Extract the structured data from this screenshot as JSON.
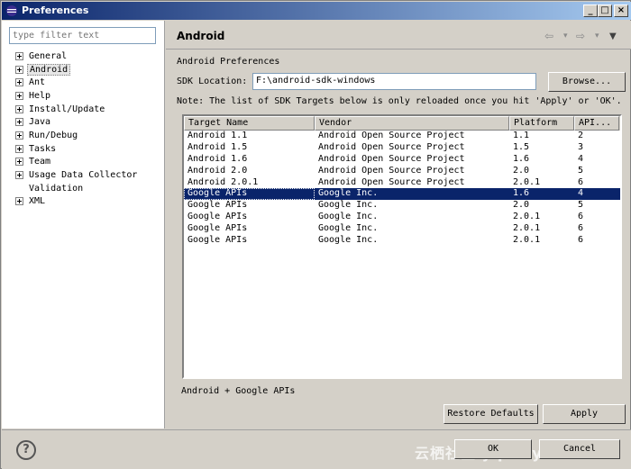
{
  "window": {
    "title": "Preferences",
    "minimize": "_",
    "maximize": "□",
    "close": "×"
  },
  "left": {
    "filter_placeholder": "type filter text",
    "tree": [
      {
        "label": "General",
        "expandable": true
      },
      {
        "label": "Android",
        "expandable": true,
        "selected": true
      },
      {
        "label": "Ant",
        "expandable": true
      },
      {
        "label": "Help",
        "expandable": true
      },
      {
        "label": "Install/Update",
        "expandable": true
      },
      {
        "label": "Java",
        "expandable": true
      },
      {
        "label": "Run/Debug",
        "expandable": true
      },
      {
        "label": "Tasks",
        "expandable": true
      },
      {
        "label": "Team",
        "expandable": true
      },
      {
        "label": "Usage Data Collector",
        "expandable": true
      },
      {
        "label": "Validation",
        "expandable": false
      },
      {
        "label": "XML",
        "expandable": true
      }
    ]
  },
  "page": {
    "title": "Android",
    "nav_back": "⇦",
    "nav_back_menu": "▾",
    "nav_forward": "⇨",
    "nav_forward_menu": "▾",
    "nav_menu": "▼",
    "section_label": "Android Preferences",
    "sdk_label": "SDK Location:",
    "sdk_value": "F:\\android-sdk-windows",
    "browse_label": "Browse...",
    "note": "Note: The list of SDK Targets below is only reloaded once you hit 'Apply' or 'OK'."
  },
  "table": {
    "headers": [
      "Target Name",
      "Vendor",
      "Platform",
      "API..."
    ],
    "rows": [
      [
        "Android 1.1",
        "Android Open Source Project",
        "1.1",
        "2"
      ],
      [
        "Android 1.5",
        "Android Open Source Project",
        "1.5",
        "3"
      ],
      [
        "Android 1.6",
        "Android Open Source Project",
        "1.6",
        "4"
      ],
      [
        "Android 2.0",
        "Android Open Source Project",
        "2.0",
        "5"
      ],
      [
        "Android 2.0.1",
        "Android Open Source Project",
        "2.0.1",
        "6"
      ],
      [
        "Google APIs",
        "Google Inc.",
        "1.6",
        "4"
      ],
      [
        "Google APIs",
        "Google Inc.",
        "2.0",
        "5"
      ],
      [
        "Google APIs",
        "Google Inc.",
        "2.0.1",
        "6"
      ],
      [
        "Google APIs",
        "Google Inc.",
        "2.0.1",
        "6"
      ],
      [
        "Google APIs",
        "Google Inc.",
        "2.0.1",
        "6"
      ]
    ],
    "selected_index": 5
  },
  "footer": {
    "status_text": "Android + Google APIs",
    "restore_defaults": "Restore Defaults",
    "apply": "Apply",
    "help": "?",
    "ok": "OK",
    "cancel": "Cancel",
    "watermark": "云栖社区 yq.aliyun.com"
  },
  "colors": {
    "selection": "#0a246a",
    "titlebar": "#0a246a",
    "chrome": "#d4d0c8"
  }
}
